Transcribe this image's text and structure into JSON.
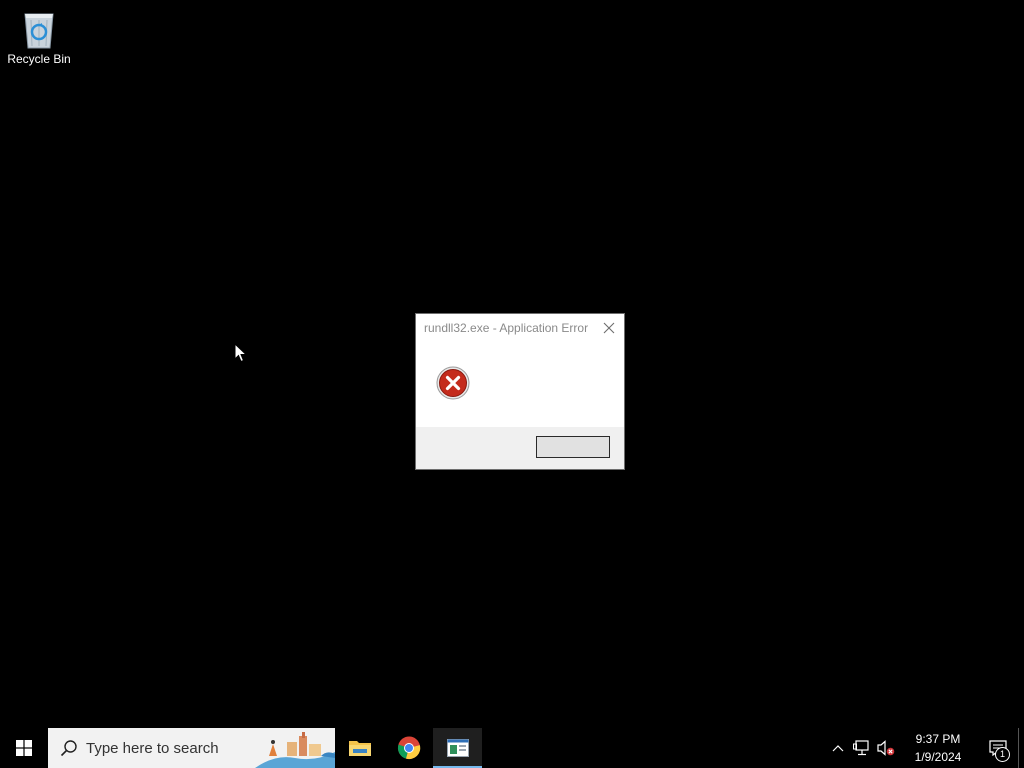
{
  "desktop": {
    "icons": [
      {
        "label": "Recycle Bin",
        "icon": "recycle-bin-icon"
      }
    ]
  },
  "dialog": {
    "title": "rundll32.exe - Application Error",
    "message": "",
    "icon": "error-icon",
    "ok_label": ""
  },
  "taskbar": {
    "search_placeholder": "Type here to search",
    "apps": [
      {
        "name": "File Explorer",
        "icon": "folder-icon"
      },
      {
        "name": "Google Chrome",
        "icon": "chrome-icon"
      },
      {
        "name": "Application window",
        "icon": "window-app-icon",
        "active": true
      }
    ],
    "clock": {
      "time": "9:37 PM",
      "date": "1/9/2024"
    },
    "notification_count": "1"
  },
  "colors": {
    "taskbar_bg": "#000000",
    "active_indicator": "#76b9ed",
    "error_red": "#c42b1c"
  }
}
